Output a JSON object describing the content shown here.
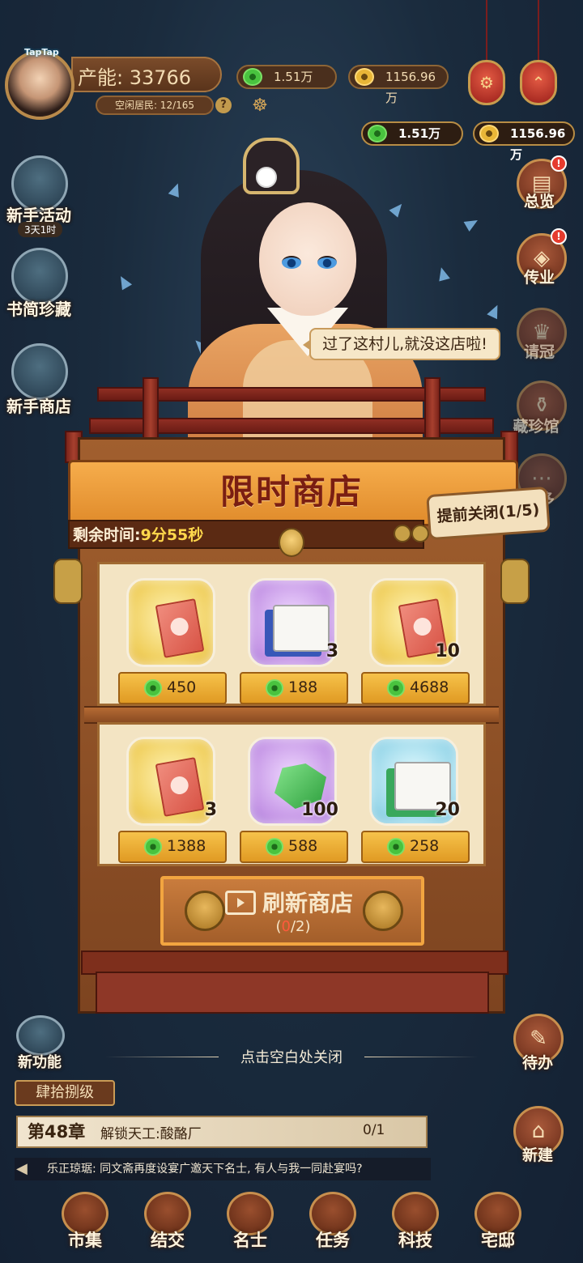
{
  "top_bar": {
    "taptap_badge": "TapTap",
    "production": "产能: 33766",
    "idle_residents": "空闲居民: 12/165",
    "help": "?",
    "res_green": "1.51万",
    "res_gold": "1156.96万"
  },
  "wallet": {
    "green": "1.51万",
    "gold": "1156.96万"
  },
  "right_menu": [
    {
      "label": "总览",
      "badge": "!"
    },
    {
      "label": "传业",
      "badge": "!"
    },
    {
      "label": "请冠"
    },
    {
      "label": "藏珍馆"
    },
    {
      "label": "更多"
    }
  ],
  "left_menu": {
    "newbie_event": "新手活动",
    "newbie_timer": "3天1时",
    "book_collection": "书简珍藏",
    "newbie_shop": "新手商店"
  },
  "speech": "过了这村儿,就没这店啦!",
  "shop": {
    "title": "限时商店",
    "timer_label": "剩余时间:",
    "timer_value": "9分55秒",
    "close_early": "提前关闭(1/5)",
    "items": [
      {
        "type": "ticket",
        "count": "",
        "price": "450",
        "frame": "gold"
      },
      {
        "type": "book",
        "count": "3",
        "price": "188",
        "frame": "purple"
      },
      {
        "type": "ticket",
        "count": "10",
        "price": "4688",
        "frame": "gold"
      },
      {
        "type": "ticket",
        "count": "3",
        "price": "1388",
        "frame": "gold"
      },
      {
        "type": "jade",
        "count": "100",
        "price": "588",
        "frame": "purple"
      },
      {
        "type": "scroll",
        "count": "20",
        "price": "258",
        "frame": "blue"
      }
    ],
    "refresh_label": "刷新商店",
    "refresh_used": "0",
    "refresh_total": "/2)",
    "refresh_open": "("
  },
  "close_hint": "点击空白处关闭",
  "hud": {
    "new_feature": "新功能",
    "todo": "待办",
    "build": "新建",
    "chapter_tag": "肆拾捌级",
    "chapter_num": "第48章",
    "chapter_task": "解锁天工:酸酪厂",
    "chapter_progress": "0/1",
    "chat": "乐正琼琚: 同文斋再度设宴广邀天下名士, 有人与我一同赴宴吗?"
  },
  "bottom_nav": [
    "市集",
    "结交",
    "名士",
    "任务",
    "科技",
    "宅邸"
  ],
  "colors": {
    "accent_gold": "#f6ad4c",
    "title_red": "#7a1e12",
    "timer_yellow": "#ffd84c",
    "badge_red": "#e63b2e"
  }
}
